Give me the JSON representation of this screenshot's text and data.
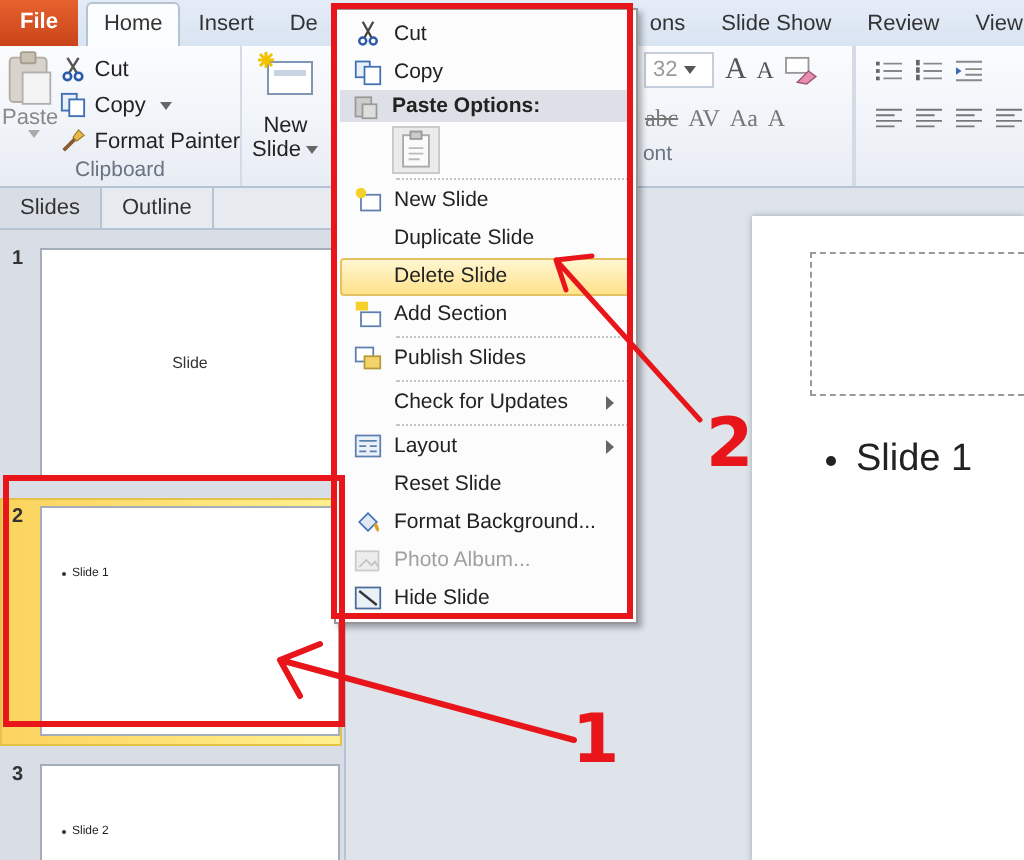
{
  "ribbon": {
    "tabs": [
      {
        "label": "File",
        "kind": "file",
        "selected": false
      },
      {
        "label": "Home",
        "kind": "tab",
        "selected": true
      },
      {
        "label": "Insert",
        "kind": "tab",
        "selected": false
      },
      {
        "label": "De",
        "kind": "tab",
        "selected": false
      },
      {
        "label": "ons",
        "kind": "tab",
        "selected": false
      },
      {
        "label": "Slide Show",
        "kind": "tab",
        "selected": false
      },
      {
        "label": "Review",
        "kind": "tab",
        "selected": false
      },
      {
        "label": "View",
        "kind": "tab",
        "selected": false
      }
    ],
    "clipboard": {
      "paste": "Paste",
      "items": [
        "Cut",
        "Copy",
        "Format Painter"
      ],
      "label": "Clipboard"
    },
    "new_slide": {
      "line1": "New",
      "line2": "Slide"
    },
    "font": {
      "size": "32",
      "grow": [
        "A",
        "A"
      ],
      "buttons": [
        "abc",
        "AV",
        "Aa",
        "A"
      ],
      "label": "ont"
    }
  },
  "pane": {
    "tabs": [
      {
        "label": "Slides",
        "selected": true
      },
      {
        "label": "Outline",
        "selected": false
      }
    ],
    "thumbnails": [
      {
        "number": "1",
        "kind": "title",
        "text": "Slide",
        "selected": false
      },
      {
        "number": "2",
        "kind": "bullet",
        "text": "Slide 1",
        "selected": true
      },
      {
        "number": "3",
        "kind": "bullet",
        "text": "Slide 2",
        "selected": false
      }
    ]
  },
  "slide": {
    "bullet": "Slide 1"
  },
  "context_menu": {
    "items": [
      {
        "kind": "item",
        "label": "Cut",
        "selected": false,
        "disabled": false,
        "submenu": false,
        "separator": false
      },
      {
        "kind": "item",
        "label": "Copy",
        "selected": false,
        "disabled": false,
        "submenu": false,
        "separator": false
      },
      {
        "kind": "header",
        "label": "Paste Options:"
      },
      {
        "kind": "paste"
      },
      {
        "kind": "item",
        "label": "New Slide",
        "selected": false,
        "disabled": false,
        "submenu": false,
        "separator": true
      },
      {
        "kind": "item",
        "label": "Duplicate Slide",
        "selected": false,
        "disabled": false,
        "submenu": false,
        "separator": false
      },
      {
        "kind": "item",
        "label": "Delete Slide",
        "selected": true,
        "disabled": false,
        "submenu": false,
        "separator": false
      },
      {
        "kind": "item",
        "label": "Add Section",
        "selected": false,
        "disabled": false,
        "submenu": false,
        "separator": false
      },
      {
        "kind": "item",
        "label": "Publish Slides",
        "selected": false,
        "disabled": false,
        "submenu": false,
        "separator": true
      },
      {
        "kind": "item",
        "label": "Check for Updates",
        "selected": false,
        "disabled": false,
        "submenu": true,
        "separator": true
      },
      {
        "kind": "item",
        "label": "Layout",
        "selected": false,
        "disabled": false,
        "submenu": true,
        "separator": true
      },
      {
        "kind": "item",
        "label": "Reset Slide",
        "selected": false,
        "disabled": false,
        "submenu": false,
        "separator": false
      },
      {
        "kind": "item",
        "label": "Format Background...",
        "selected": false,
        "disabled": false,
        "submenu": false,
        "separator": false
      },
      {
        "kind": "item",
        "label": "Photo Album...",
        "selected": false,
        "disabled": true,
        "submenu": false,
        "separator": false
      },
      {
        "kind": "item",
        "label": "Hide Slide",
        "selected": false,
        "disabled": false,
        "submenu": false,
        "separator": false
      }
    ]
  },
  "callouts": [
    {
      "number": "1"
    },
    {
      "number": "2"
    }
  ]
}
